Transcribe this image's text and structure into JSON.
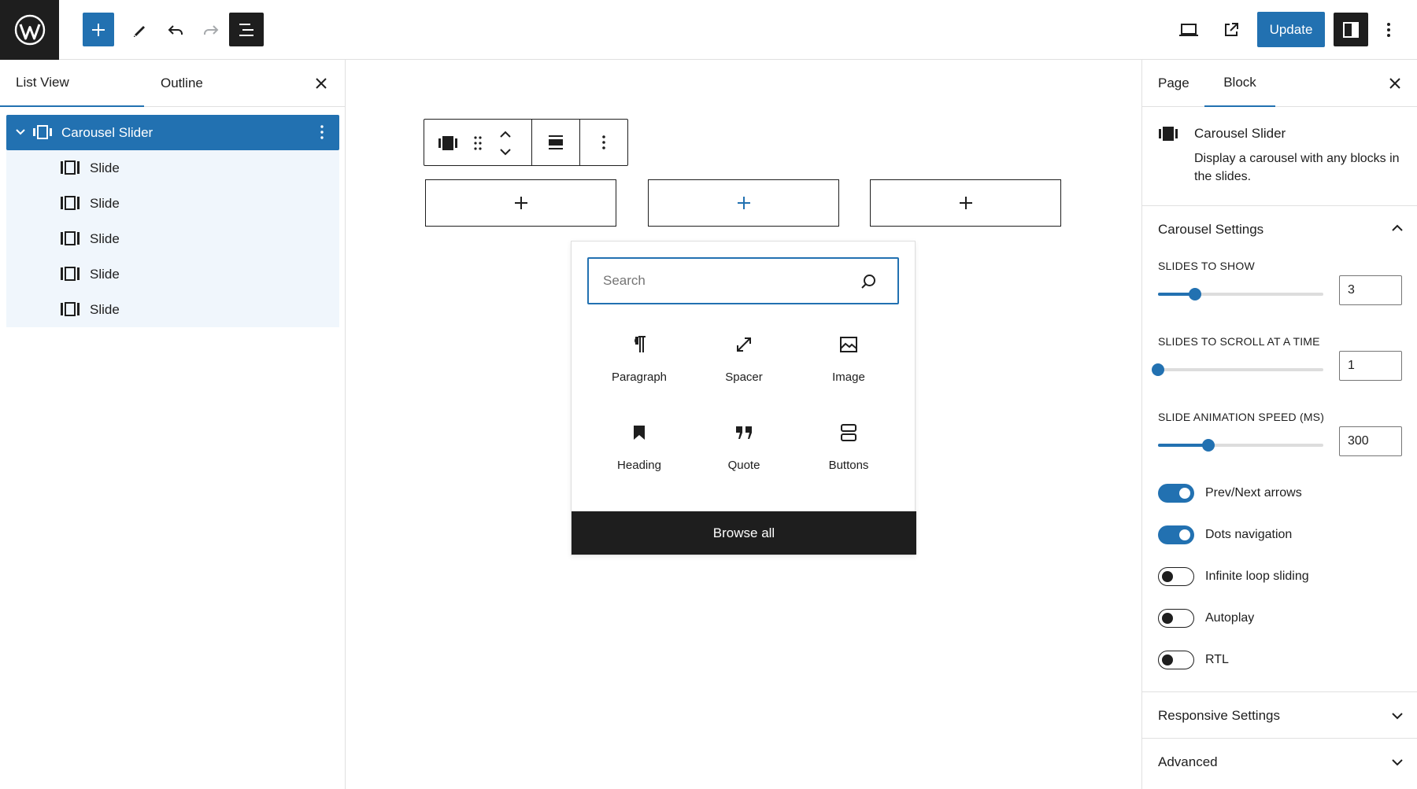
{
  "topbar": {
    "update_label": "Update"
  },
  "left_panel": {
    "tabs": [
      "List View",
      "Outline"
    ],
    "tree": {
      "parent": "Carousel Slider",
      "children": [
        "Slide",
        "Slide",
        "Slide",
        "Slide",
        "Slide"
      ]
    }
  },
  "canvas": {
    "inserter": {
      "search_placeholder": "Search",
      "blocks": [
        {
          "label": "Paragraph",
          "icon": "paragraph-icon"
        },
        {
          "label": "Spacer",
          "icon": "spacer-icon"
        },
        {
          "label": "Image",
          "icon": "image-icon"
        },
        {
          "label": "Heading",
          "icon": "heading-icon"
        },
        {
          "label": "Quote",
          "icon": "quote-icon"
        },
        {
          "label": "Buttons",
          "icon": "buttons-icon"
        }
      ],
      "browse_all": "Browse all"
    }
  },
  "right_panel": {
    "tabs": [
      "Page",
      "Block"
    ],
    "block_card": {
      "name": "Carousel Slider",
      "description": "Display a carousel with any blocks in the slides."
    },
    "carousel_settings": {
      "title": "Carousel Settings",
      "slides_to_show": {
        "label": "SLIDES TO SHOW",
        "value": "3",
        "fraction": 0.2
      },
      "slides_to_scroll": {
        "label": "SLIDES TO SCROLL AT A TIME",
        "value": "1",
        "fraction": 0.0
      },
      "animation_speed": {
        "label": "SLIDE ANIMATION SPEED (MS)",
        "value": "300",
        "fraction": 0.27
      },
      "toggles": [
        {
          "label": "Prev/Next arrows",
          "on": true
        },
        {
          "label": "Dots navigation",
          "on": true
        },
        {
          "label": "Infinite loop sliding",
          "on": false
        },
        {
          "label": "Autoplay",
          "on": false
        },
        {
          "label": "RTL",
          "on": false
        }
      ]
    },
    "responsive_settings": "Responsive Settings",
    "advanced": "Advanced"
  },
  "colors": {
    "accent": "#2271b1",
    "dark": "#1e1e1e",
    "tree_bg": "#f0f6fc"
  }
}
